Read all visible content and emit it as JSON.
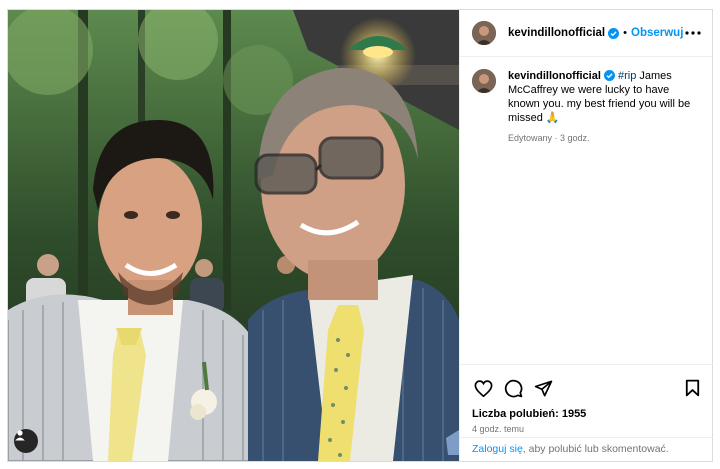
{
  "post": {
    "username": "kevindillonofficial",
    "follow_label": "Obserwuj",
    "separator": "•",
    "caption": {
      "hashtag": "#rip",
      "text": "James McCaffrey we were lucky to have known you. my best friend you will be missed",
      "emoji": "🙏",
      "edited_meta": "Edytowany · 3 godz."
    },
    "likes_text": "Liczba polubień: 1955",
    "time_ago": "4 godz. temu",
    "login": {
      "link": "Zaloguj się",
      "rest": ", aby polubić lub skomentować."
    }
  },
  "icons": {
    "verified": "verified-badge-icon",
    "more": "more-options-icon",
    "like": "heart-icon",
    "comment": "comment-icon",
    "share": "send-icon",
    "save": "bookmark-icon",
    "tag": "user-tag-icon"
  },
  "colors": {
    "accent": "#0095f6",
    "hashtag": "#00376b",
    "muted": "#737373",
    "border": "#dbdbdb"
  }
}
